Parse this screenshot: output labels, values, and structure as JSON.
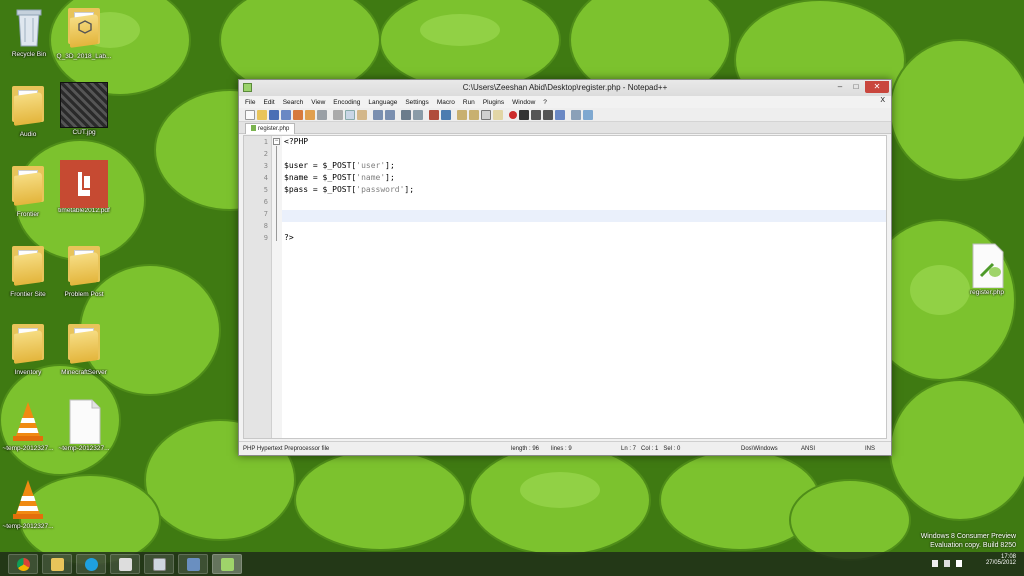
{
  "desktop": {
    "icons": [
      {
        "label": "Recycle Bin"
      },
      {
        "label": "Q_3D_2018_Lab..."
      },
      {
        "label": "Audio"
      },
      {
        "label": "CUT.jpg"
      },
      {
        "label": "Frontier"
      },
      {
        "label": "timetable2012.pdf"
      },
      {
        "label": "Frontier Site"
      },
      {
        "label": "Problem Post"
      },
      {
        "label": "Inventory"
      },
      {
        "label": "MinecraftServer"
      },
      {
        "label": "~temp-2012327..."
      },
      {
        "label": "~temp-2012327..."
      },
      {
        "label": "~temp-2012327..."
      },
      {
        "label": "register.php"
      }
    ]
  },
  "window": {
    "title": "C:\\Users\\Zeeshan Abid\\Desktop\\register.php - Notepad++",
    "min": "–",
    "max": "□",
    "close": "✕"
  },
  "menu": {
    "items": [
      "File",
      "Edit",
      "Search",
      "View",
      "Encoding",
      "Language",
      "Settings",
      "Macro",
      "Run",
      "Plugins",
      "Window",
      "?"
    ],
    "close": "X"
  },
  "tab": {
    "label": "register.php"
  },
  "editor": {
    "line_numbers": [
      "1",
      "2",
      "3",
      "4",
      "5",
      "6",
      "7",
      "8",
      "9"
    ],
    "lines": [
      {
        "code": "<?PHP",
        "var": "",
        "str": "",
        "end": ""
      },
      {
        "code": "",
        "var": "",
        "str": "",
        "end": ""
      },
      {
        "code": "$user = $_POST[",
        "str": "'user'",
        "end": "];"
      },
      {
        "code": "$name = $_POST[",
        "str": "'name'",
        "end": "];"
      },
      {
        "code": "$pass = $_POST[",
        "str": "'password'",
        "end": "];"
      },
      {
        "code": "",
        "str": "",
        "end": ""
      },
      {
        "code": "",
        "str": "",
        "end": ""
      },
      {
        "code": "",
        "str": "",
        "end": ""
      },
      {
        "code": "?>",
        "str": "",
        "end": ""
      }
    ]
  },
  "status": {
    "filetype": "PHP Hypertext Preprocessor file",
    "length": "length : 96",
    "lines": "lines : 9",
    "position": "Ln : 7   Col : 1   Sel : 0",
    "eol": "Dos\\Windows",
    "encoding": "ANSI",
    "mode": "INS"
  },
  "tray": {
    "time": "17:08",
    "date": "27/05/2012"
  },
  "watermark": {
    "line1": "Windows 8 Consumer Preview",
    "line2": "Evaluation copy. Build 8250"
  },
  "colors": {
    "wallpaper": "#5f9e1f",
    "close_button": "#c9463d",
    "current_line": "#eaf0fb"
  }
}
